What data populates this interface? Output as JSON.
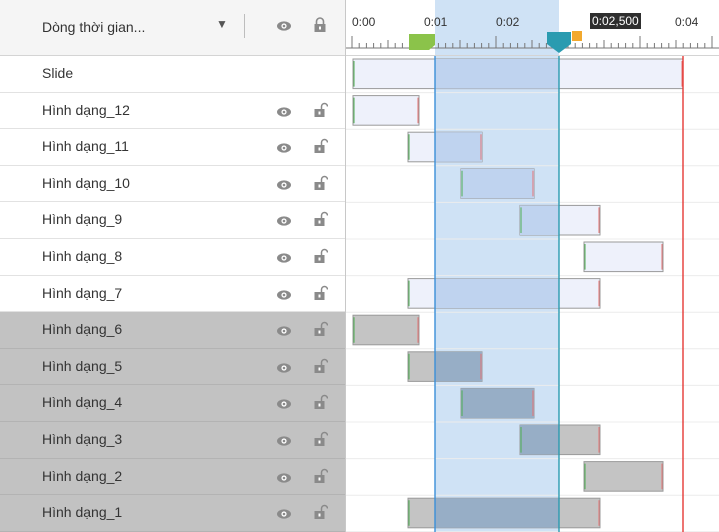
{
  "header": {
    "title": "Dòng thời gian...",
    "dropdown_icon": "caret-down-icon",
    "visibility_icon": "eye-icon",
    "lock_icon": "lock-icon"
  },
  "ruler": {
    "ticks": [
      "0:00",
      "0:01",
      "0:02",
      "0:04"
    ],
    "current_time": "0:02,500"
  },
  "layers": [
    {
      "label": "Slide",
      "selected": false,
      "show_icons": false
    },
    {
      "label": "Hình dạng_12",
      "selected": false,
      "show_icons": true
    },
    {
      "label": "Hình dạng_11",
      "selected": false,
      "show_icons": true
    },
    {
      "label": "Hình dạng_10",
      "selected": false,
      "show_icons": true
    },
    {
      "label": "Hình dạng_9",
      "selected": false,
      "show_icons": true
    },
    {
      "label": "Hình dạng_8",
      "selected": false,
      "show_icons": true
    },
    {
      "label": "Hình dạng_7",
      "selected": false,
      "show_icons": true
    },
    {
      "label": "Hình dạng_6",
      "selected": true,
      "show_icons": true
    },
    {
      "label": "Hình dạng_5",
      "selected": true,
      "show_icons": true
    },
    {
      "label": "Hình dạng_4",
      "selected": true,
      "show_icons": true
    },
    {
      "label": "Hình dạng_3",
      "selected": true,
      "show_icons": true
    },
    {
      "label": "Hình dạng_2",
      "selected": true,
      "show_icons": true
    },
    {
      "label": "Hình dạng_1",
      "selected": true,
      "show_icons": true
    }
  ],
  "colors": {
    "selection_region": "#cfe2f5",
    "playhead": "#2a9bb0",
    "start_marker": "#8bc34a",
    "end_marker": "#f2a92e",
    "slide_end_line": "#e53935",
    "bar_unselected": "#eef1fb",
    "bar_selected": "#c4c4c4"
  }
}
